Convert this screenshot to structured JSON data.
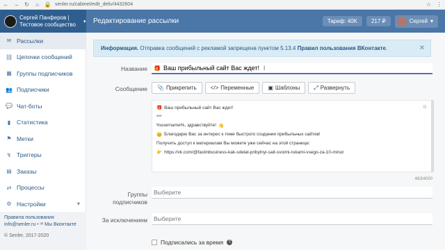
{
  "browser": {
    "url": "senler.ru/cabinet/edit_deliv/4432604"
  },
  "header": {
    "user_name": "Сергей Панферов | Тестовое сообщество",
    "title": "Редактирование рассылки",
    "tariff": "Тариф: 40K",
    "balance": "217 ₽",
    "account": "Сергей"
  },
  "sidebar": {
    "items": [
      {
        "label": "Рассылки",
        "icon": "envelope-icon"
      },
      {
        "label": "Цепочки сообщений",
        "icon": "chain-icon"
      },
      {
        "label": "Группы подписчиков",
        "icon": "groups-icon"
      },
      {
        "label": "Подписчики",
        "icon": "users-icon"
      },
      {
        "label": "Чат-боты",
        "icon": "chat-icon"
      },
      {
        "label": "Статистика",
        "icon": "stats-icon"
      },
      {
        "label": "Метки",
        "icon": "tag-icon"
      },
      {
        "label": "Триггеры",
        "icon": "trigger-icon"
      },
      {
        "label": "Заказы",
        "icon": "cart-icon"
      },
      {
        "label": "Процессы",
        "icon": "process-icon"
      },
      {
        "label": "Настройки",
        "icon": "gear-icon"
      }
    ],
    "footer": {
      "rules": "Правила пользования",
      "email": "info@senler.ru",
      "vk": "Мы Вконтакте",
      "copyright": "© Senler, 2017-2020"
    }
  },
  "alert": {
    "prefix": "Информация.",
    "text": " Отправка сообщений с рекламой запрещена пунктом 5.13.4 ",
    "link": "Правил пользования ВКонтакте",
    "suffix": "."
  },
  "form": {
    "name_label": "Название",
    "name_value": "Ваш прибыльный сайт Вас ждет!",
    "message_label": "Сообщение",
    "toolbar": {
      "attach": "Прикрепить",
      "variables": "Переменные",
      "templates": "Шаблоны",
      "expand": "Развернуть"
    },
    "message_lines": [
      "Ваш прибыльный сайт Вас ждет!",
      "***",
      "%username%, здравствуйте!",
      "Благодарю Вас за интерес к теме быстрого создания прибыльных сайтов!",
      "Получить доступ к материалам Вы можете уже сейчас на этой странице:",
      "https://vk.com/@fastinbusiness-kak-sdelat-pribylnyi-sait-svoimi-rukami-vsego-za-10-minut"
    ],
    "counter": "663/4000",
    "groups_label": "Группы подписчиков",
    "groups_placeholder": "Выберите",
    "exclude_label": "За исключением",
    "exclude_placeholder": "Выберите",
    "subscribed_label": "Подписались за время"
  }
}
